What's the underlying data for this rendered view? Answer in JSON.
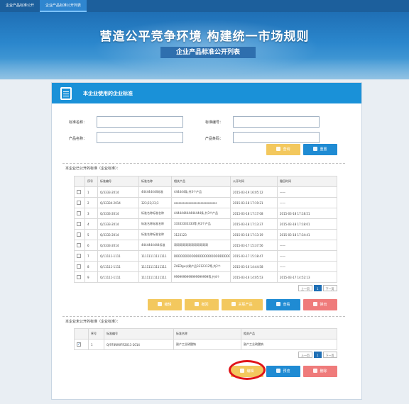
{
  "nav": {
    "tabs": [
      "企业产品标准公开",
      "企业产品标准公开列表"
    ]
  },
  "banner": {
    "title": "营造公平竞争环境 构建统一市场规则",
    "subtitle": "企业产品标准公开列表"
  },
  "panel": {
    "title": "本企业使用的企业标准"
  },
  "search": {
    "std_name_label": "标准名称：",
    "std_code_label": "标准编号：",
    "product_name_label": "产品名称：",
    "product_code_label": "产品条码：",
    "std_name_value": "",
    "std_code_value": "",
    "product_name_value": "",
    "product_code_value": "",
    "query_btn": "查询",
    "reset_btn": "重置"
  },
  "public_section": {
    "title": "本企业已公开的标准（企业标准）：",
    "headers": [
      "序号",
      "标准编号",
      "标准名称",
      "相关产品",
      "公开时间",
      "撤回时间"
    ],
    "rows": [
      [
        "1",
        "Q/3333-2014",
        "444444444标准",
        "444444条,共3个产品",
        "2015-03-19 16:05:12",
        "——"
      ],
      [
        "2",
        "Q/33334-2014",
        "323;23;23;3",
        "sssssssssssssssssssssssssssss",
        "2015-03-18 17:19:21",
        "——"
      ],
      [
        "3",
        "Q/3333-2014",
        "标准名称标准名称",
        "444444444444444条,共3个产品",
        "2015-03-18 17:17:08",
        "2015-03-18 17:18:51"
      ],
      [
        "4",
        "Q/2333-2014",
        "标准名称标准名称",
        "33333333333等,共2个产品",
        "2015-03-18 17:13:37",
        "2015-03-18 17:18:01"
      ],
      [
        "5",
        "Q/3333-2014",
        "标准名称标准名称",
        "3123123",
        "2015-03-18 17:13:19",
        "2015-03-18 17:34:41"
      ],
      [
        "6",
        "Q/3333-2014",
        "4444444444标准",
        "哥哥哥哥哥哥哥哥哥哥哥哥",
        "2015-03-17 15:37:56",
        "——"
      ],
      [
        "7",
        "Q/11111-1111",
        "11111111111111",
        "DDDDDDDDDDDDDDDDDDDDDDDDDDD",
        "2015-03-17 15:18:47",
        "——"
      ],
      [
        "8",
        "Q/11111-1111",
        "11111111111111",
        "ZAEDgu水果产品3312312等,共2个",
        "2015-03-16 14:44:58",
        "——"
      ],
      [
        "9",
        "Q/11111-1111",
        "11111111111111",
        "9999999999999999999等,共4个",
        "2015-03-16 14:05:53",
        "2015-03-17 14:52:13"
      ]
    ],
    "pager": {
      "prev": "上一页",
      "current": "1",
      "next": "下一页"
    },
    "buttons": {
      "edit": "编辑",
      "cancel": "撤回",
      "release_product": "关联产品",
      "view": "查看",
      "delete": "弹出"
    }
  },
  "private_section": {
    "title": "本企业未公开的标准（企业标准）：",
    "headers": [
      "序号",
      "标准编号",
      "标准名称",
      "相关产品"
    ],
    "rows": [
      [
        "1",
        "Q/978WWFR2011-2014",
        "副产工业硫酸钠",
        "副产工业硫酸钠"
      ]
    ],
    "pager": {
      "prev": "上一页",
      "current": "1",
      "next": "下一页"
    },
    "buttons": {
      "edit": "编辑",
      "preview": "预览",
      "delete": "删除"
    }
  }
}
